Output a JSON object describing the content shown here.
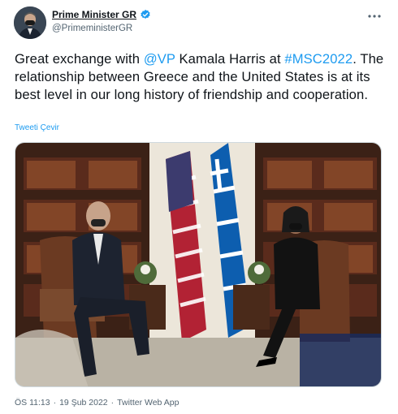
{
  "author": {
    "display_name": "Prime Minister GR",
    "handle": "@PrimeministerGR",
    "avatar_icon": "person-avatar",
    "verified_icon": "verified-badge-icon"
  },
  "tweet": {
    "text_before_mention": "Great exchange with ",
    "mention": "@VP",
    "text_after_mention": " Kamala Harris at ",
    "hashtag": "#MSC2022",
    "text_after_hashtag": ". The relationship between Greece and the United States is at its best level in our long history of friendship and cooperation.",
    "translate_label": "Tweeti Çevir"
  },
  "meta": {
    "time": "ÖS 11:13",
    "separator1": "·",
    "date": "19 Şub 2022",
    "separator2": "·",
    "app": "Twitter Web App"
  },
  "colors": {
    "link": "#1d9bf0",
    "secondary_text": "#536471",
    "primary_text": "#0f1419"
  }
}
